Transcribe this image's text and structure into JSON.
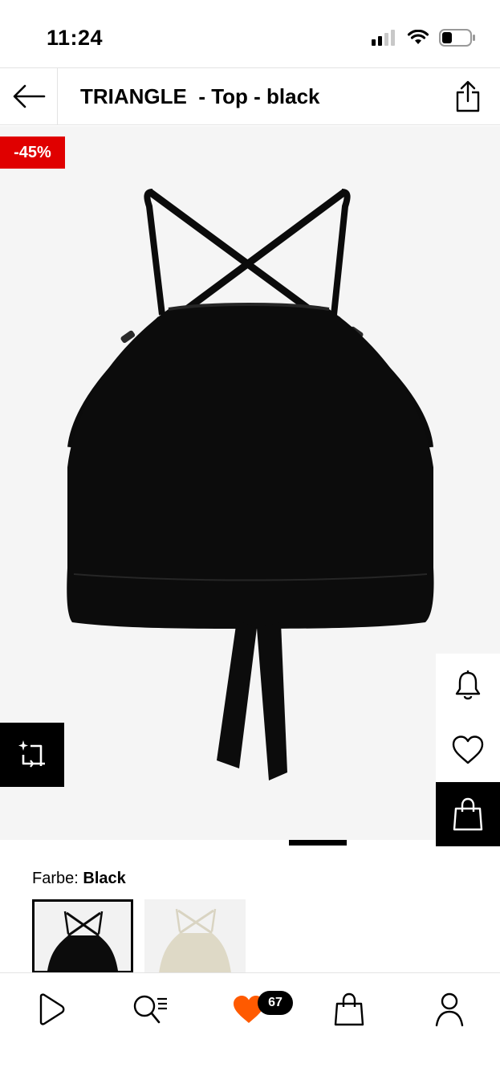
{
  "status_bar": {
    "time": "11:24",
    "icons": [
      "cellular-signal-icon",
      "wifi-icon",
      "battery-icon"
    ]
  },
  "header": {
    "title": "TRIANGLE  - Top - black",
    "back_icon": "arrow-left-icon",
    "share_icon": "share-icon"
  },
  "product": {
    "discount_badge": "-45%",
    "image_subject": "black halter crop top",
    "carousel": {
      "current": 1,
      "total": 2
    },
    "side_actions": [
      "bell-icon",
      "heart-icon",
      "shopping-bag-icon"
    ],
    "ai_button_icon": "sparkle-crop-icon"
  },
  "color": {
    "label": "Farbe:",
    "selected_value": "Black",
    "swatches": [
      {
        "name": "Black",
        "selected": true
      },
      {
        "name": "Beige",
        "selected": false
      }
    ]
  },
  "bottom_nav": {
    "items": [
      "home-icon",
      "search-icon",
      "wishlist-icon",
      "bag-icon",
      "profile-icon"
    ],
    "wishlist_count": "67"
  },
  "colors": {
    "accent_red": "#e00000",
    "wishlist_orange": "#ff5a00",
    "product_bg": "#f5f5f5"
  }
}
